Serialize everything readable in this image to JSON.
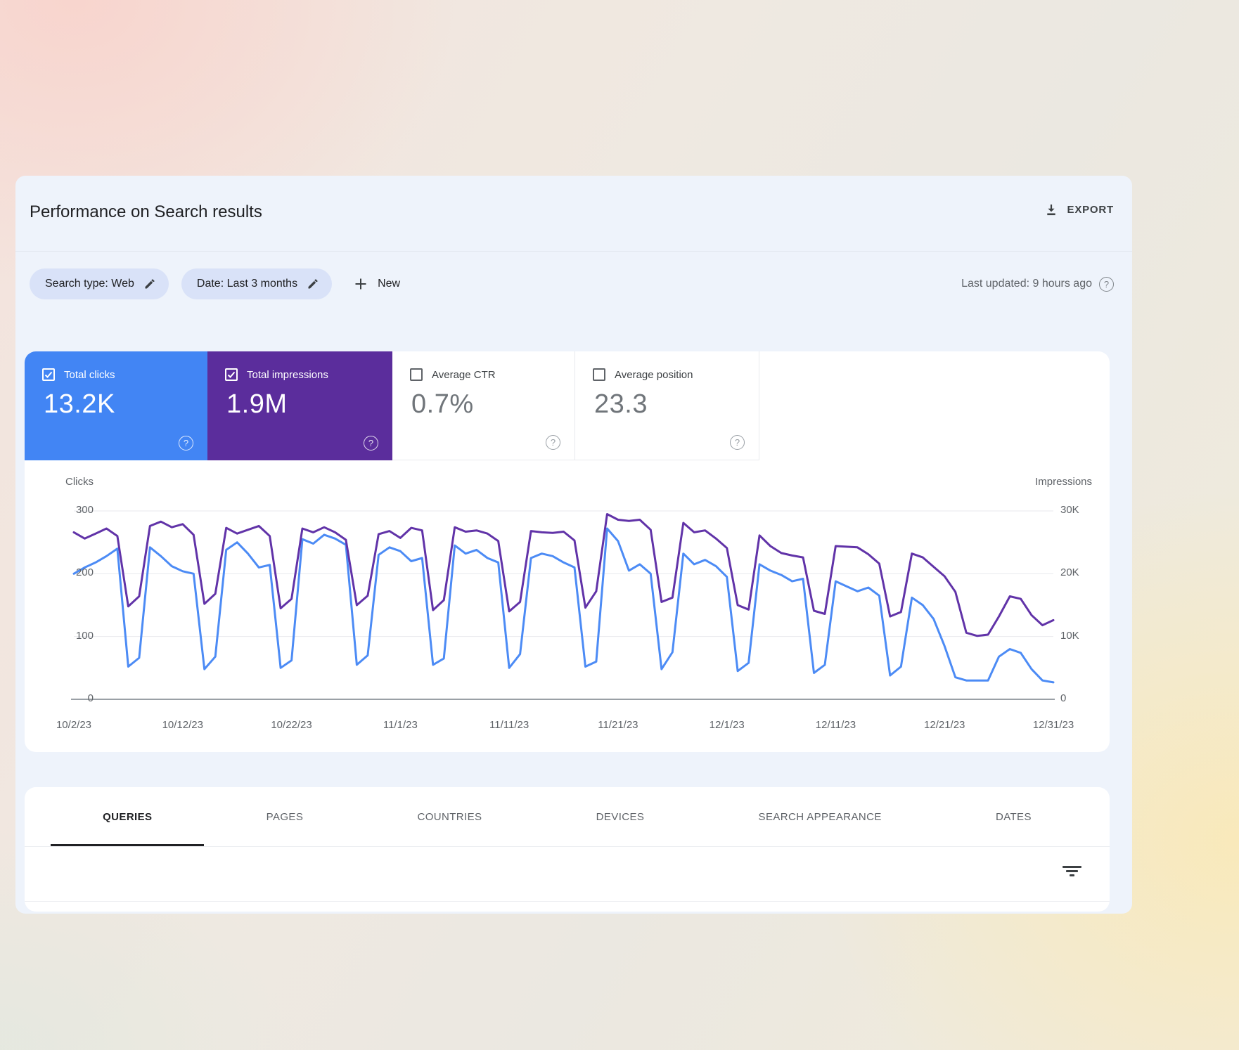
{
  "header": {
    "title": "Performance on Search results",
    "export_label": "EXPORT"
  },
  "filters": {
    "chips": [
      {
        "label": "Search type: Web"
      },
      {
        "label": "Date: Last 3 months"
      }
    ],
    "new_label": "New",
    "last_updated": "Last updated: 9 hours ago"
  },
  "metrics": [
    {
      "label": "Total clicks",
      "value": "13.2K",
      "checked": true,
      "color": "#4285f4"
    },
    {
      "label": "Total impressions",
      "value": "1.9M",
      "checked": true,
      "color": "#5b2d9c"
    },
    {
      "label": "Average CTR",
      "value": "0.7%",
      "checked": false,
      "color": ""
    },
    {
      "label": "Average position",
      "value": "23.3",
      "checked": false,
      "color": ""
    }
  ],
  "chart_data": {
    "type": "line",
    "title": "Clicks and Impressions over time",
    "x_days": 91,
    "x_tick_labels": [
      "10/2/23",
      "10/12/23",
      "10/22/23",
      "11/1/23",
      "11/11/23",
      "11/21/23",
      "12/1/23",
      "12/11/23",
      "12/21/23",
      "12/31/23"
    ],
    "x_tick_day_indices": [
      0,
      10,
      20,
      30,
      40,
      50,
      60,
      70,
      80,
      90
    ],
    "left_axis": {
      "label": "Clicks",
      "ticks": [
        "300",
        "200",
        "100",
        "0"
      ],
      "max": 300
    },
    "right_axis": {
      "label": "Impressions",
      "ticks": [
        "30K",
        "20K",
        "10K",
        "0"
      ],
      "max": 30000
    },
    "grid_color": "#e8eaed",
    "baseline_color": "#9aa0a6",
    "legend_position": "none",
    "series": [
      {
        "name": "Clicks",
        "axis": "left",
        "color": "#4c8bf5",
        "values": [
          200,
          210,
          218,
          228,
          240,
          52,
          66,
          242,
          228,
          212,
          204,
          200,
          48,
          68,
          238,
          250,
          232,
          210,
          214,
          50,
          62,
          255,
          248,
          262,
          256,
          246,
          55,
          70,
          230,
          242,
          236,
          220,
          225,
          55,
          65,
          245,
          232,
          238,
          225,
          218,
          50,
          72,
          225,
          232,
          228,
          218,
          210,
          52,
          60,
          272,
          252,
          205,
          215,
          200,
          48,
          75,
          232,
          215,
          222,
          212,
          195,
          45,
          58,
          215,
          205,
          198,
          188,
          192,
          42,
          55,
          188,
          180,
          172,
          178,
          165,
          38,
          52,
          162,
          150,
          128,
          85,
          35,
          30,
          30,
          30,
          68,
          80,
          74,
          48,
          30,
          27
        ]
      },
      {
        "name": "Impressions",
        "axis": "right",
        "color": "#6133a8",
        "values": [
          26600,
          25600,
          26400,
          27200,
          26000,
          14800,
          16400,
          27600,
          28300,
          27400,
          27900,
          26200,
          15200,
          16800,
          27300,
          26400,
          27000,
          27600,
          26000,
          14500,
          16000,
          27200,
          26600,
          27400,
          26600,
          25400,
          15000,
          16500,
          26300,
          26800,
          25700,
          27300,
          26900,
          14200,
          15800,
          27400,
          26700,
          26900,
          26400,
          25200,
          14000,
          15500,
          26800,
          26600,
          26500,
          26700,
          25300,
          14600,
          17200,
          29500,
          28600,
          28400,
          28600,
          27000,
          15500,
          16200,
          28100,
          26600,
          26900,
          25600,
          24100,
          15000,
          14300,
          26100,
          24400,
          23300,
          22900,
          22600,
          14100,
          13600,
          24400,
          24300,
          24200,
          23100,
          21600,
          13200,
          13900,
          23200,
          22600,
          21100,
          19600,
          17100,
          10600,
          10100,
          10300,
          13200,
          16400,
          16000,
          13400,
          11800,
          12600
        ]
      }
    ]
  },
  "tabs": [
    "QUERIES",
    "PAGES",
    "COUNTRIES",
    "DEVICES",
    "SEARCH APPEARANCE",
    "DATES"
  ]
}
